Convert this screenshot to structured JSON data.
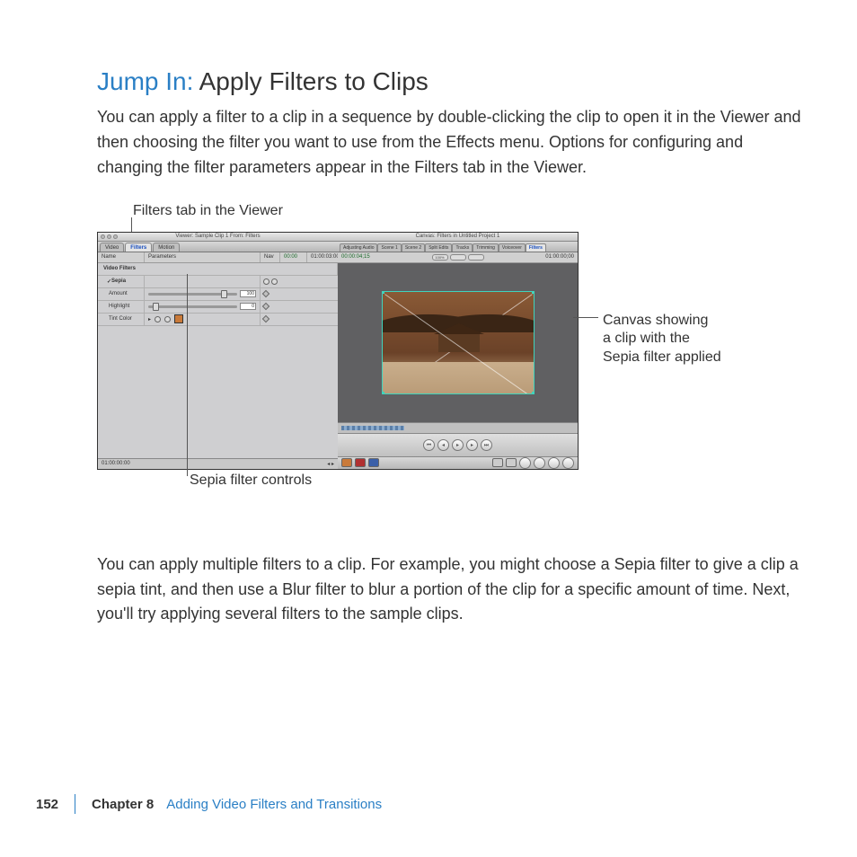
{
  "heading": {
    "jump_in": "Jump In:",
    "title": " Apply Filters to Clips"
  },
  "intro": "You can apply a filter to a clip in a sequence by double-clicking the clip to open it in the Viewer and then choosing the filter you want to use from the Effects menu. Options for configuring and changing the filter parameters appear in the Filters tab in the Viewer.",
  "callouts": {
    "top": "Filters tab in the Viewer",
    "right_line1": "Canvas showing",
    "right_line2": "a clip with the",
    "right_line3": "Sepia filter applied",
    "bottom": "Sepia filter controls"
  },
  "viewer": {
    "title": "Viewer: Sample Clip 1 From: Filters",
    "tabs": {
      "video": "Video",
      "filters": "Filters",
      "motion": "Motion"
    },
    "cols": {
      "name": "Name",
      "params": "Parameters",
      "nav": "Nav"
    },
    "tc_left": "00:00",
    "tc_right": "01:00:03:00",
    "rows": {
      "video_filters": "Video Filters",
      "sepia": "Sepia",
      "amount": "Amount",
      "highlight": "Highlight",
      "tint": "Tint Color"
    },
    "vals": {
      "amount": "100",
      "highlight": "0"
    },
    "bottom_tc": "01:00:00:00"
  },
  "canvas": {
    "title": "Canvas: Filters in Untitled Project 1",
    "tabs": [
      "Adjusting Audio",
      "Scene 1",
      "Scene 2",
      "Split Edits",
      "Tracks",
      "Trimming",
      "Voiceover",
      "Filters"
    ],
    "tc_left": "00:00:04;15",
    "tc_right": "01:00:00;00",
    "zoom": "100%"
  },
  "body": "You can apply multiple filters to a clip. For example, you might choose a Sepia filter to give a clip a sepia tint, and then use a Blur filter to blur a portion of the clip for a specific amount of time. Next, you'll try applying several filters to the sample clips.",
  "footer": {
    "page": "152",
    "chapter_label": "Chapter 8",
    "chapter_title": "Adding Video Filters and Transitions"
  }
}
